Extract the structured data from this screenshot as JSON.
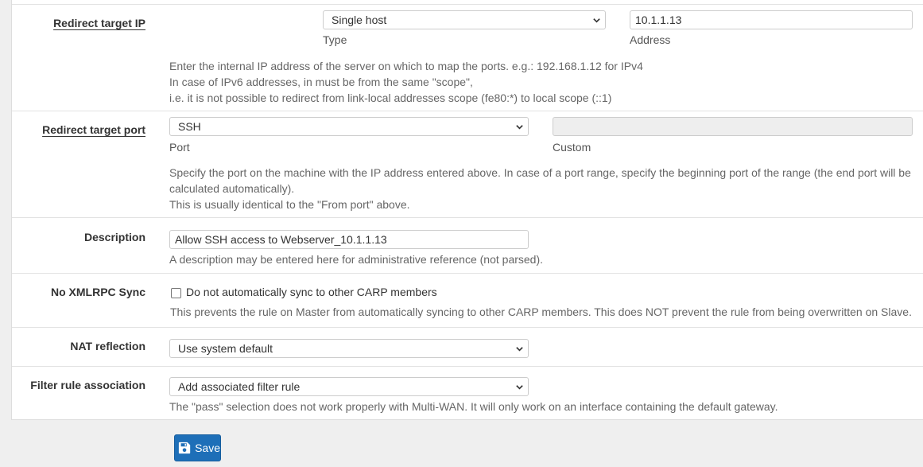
{
  "redirect_target_ip": {
    "label": "Redirect target IP",
    "type_value": "Single host",
    "type_label": "Type",
    "address_value": "10.1.1.13",
    "address_label": "Address",
    "help": [
      "Enter the internal IP address of the server on which to map the ports. e.g.: 192.168.1.12 for IPv4",
      "In case of IPv6 addresses, in must be from the same \"scope\",",
      "i.e. it is not possible to redirect from link-local addresses scope (fe80:*) to local scope (::1)"
    ]
  },
  "redirect_target_port": {
    "label": "Redirect target port",
    "port_value": "SSH",
    "port_label": "Port",
    "custom_value": "",
    "custom_label": "Custom",
    "help": [
      "Specify the port on the machine with the IP address entered above. In case of a port range, specify the beginning port of the range (the end port will be",
      "calculated automatically).",
      "This is usually identical to the \"From port\" above."
    ]
  },
  "description": {
    "label": "Description",
    "value": "Allow SSH access to Webserver_10.1.1.13",
    "help": "A description may be entered here for administrative reference (not parsed)."
  },
  "no_xmlrpc_sync": {
    "label": "No XMLRPC Sync",
    "checked": false,
    "checkbox_label": "Do not automatically sync to other CARP members",
    "help": "This prevents the rule on Master from automatically syncing to other CARP members. This does NOT prevent the rule from being overwritten on Slave."
  },
  "nat_reflection": {
    "label": "NAT reflection",
    "value": "Use system default"
  },
  "filter_rule_association": {
    "label": "Filter rule association",
    "value": "Add associated filter rule",
    "help": "The \"pass\" selection does not work properly with Multi-WAN. It will only work on an interface containing the default gateway."
  },
  "save_button": {
    "label": "Save",
    "icon": "floppy-disk-icon",
    "color": "#1e6fb8"
  }
}
